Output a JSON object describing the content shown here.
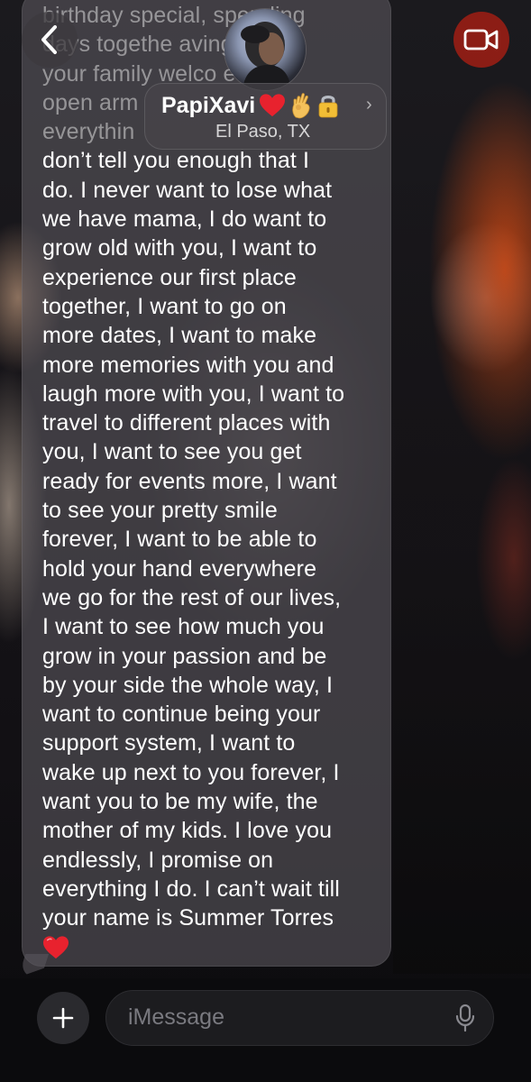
{
  "header": {
    "back_icon": "chevron-left-icon",
    "contact_name": "PapiXavi",
    "contact_name_emojis": [
      "red-heart",
      "ok-hand",
      "lock"
    ],
    "contact_location": "El Paso, TX",
    "chevron": "›",
    "video_icon": "video-camera-icon"
  },
  "message": {
    "faded_lines": [
      "birthday special, spending",
      "days togethe      aving",
      "your family welco      e with",
      "open arm",
      "everythin"
    ],
    "lines": [
      "don’t tell you enough that I",
      "do. I never want to lose what",
      "we have mama, I do want to",
      "grow old with you, I want to",
      "experience our first place",
      "together, I want to go on",
      "more dates, I want to make",
      "more memories with you and",
      "laugh more with you, I want to",
      "travel to different places with",
      "you, I want to see you get",
      "ready for events more, I want",
      "to see your pretty smile",
      "forever, I want to be able to",
      "hold your hand everywhere",
      "we go for the rest of our lives,",
      "I want to see how much you",
      "grow in your passion and be",
      "by your side the whole way, I",
      "want to continue being your",
      "support system, I want to",
      "wake up next to you forever, I",
      "want you to be my wife, the",
      "mother of my kids. I love you",
      "endlessly, I promise on",
      "everything I do. I can’t wait till",
      "your name is Summer Torres"
    ],
    "trailing_emoji": "red-heart"
  },
  "composer": {
    "plus_icon": "plus-icon",
    "placeholder": "iMessage",
    "mic_icon": "microphone-icon"
  },
  "colors": {
    "bubble": "#58565C",
    "video_button": "#A01E14",
    "heart": "#E8222E",
    "text": "#FFFFFF"
  }
}
